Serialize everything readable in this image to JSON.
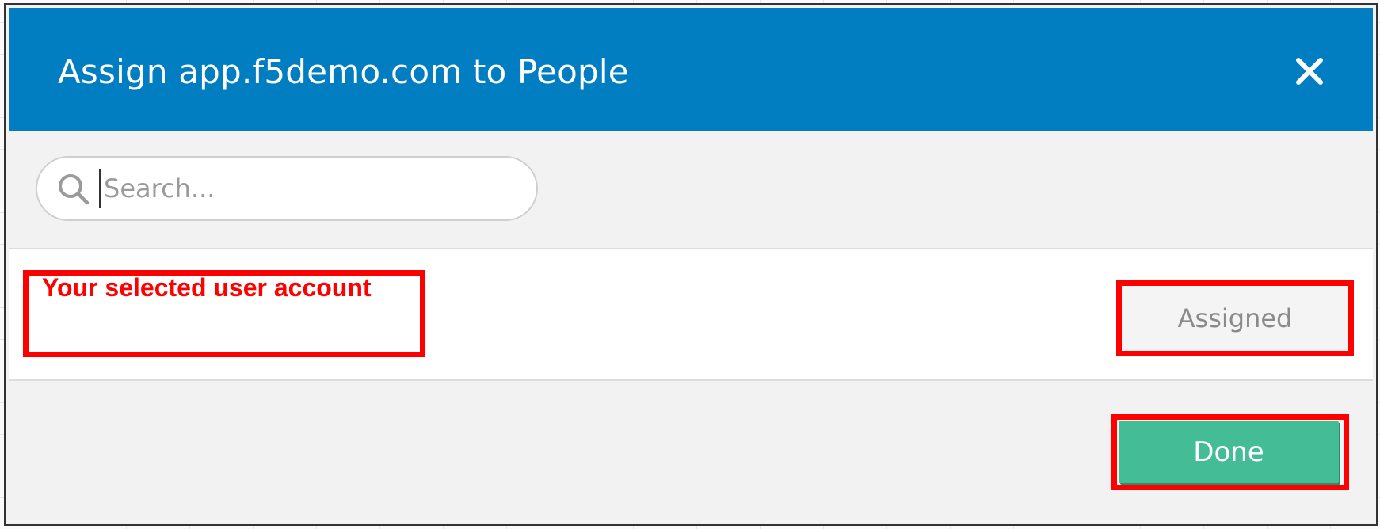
{
  "dialog": {
    "title": "Assign app.f5demo.com to People",
    "close_icon": "close-icon"
  },
  "search": {
    "placeholder": "Search...",
    "value": "",
    "icon": "search-icon"
  },
  "user_row": {
    "annotation_label": "Your selected user account",
    "status_button_label": "Assigned"
  },
  "footer": {
    "done_label": "Done"
  },
  "colors": {
    "header_bg": "#017dc2",
    "done_bg": "#44bc96",
    "annotation_red": "#ff0000"
  }
}
